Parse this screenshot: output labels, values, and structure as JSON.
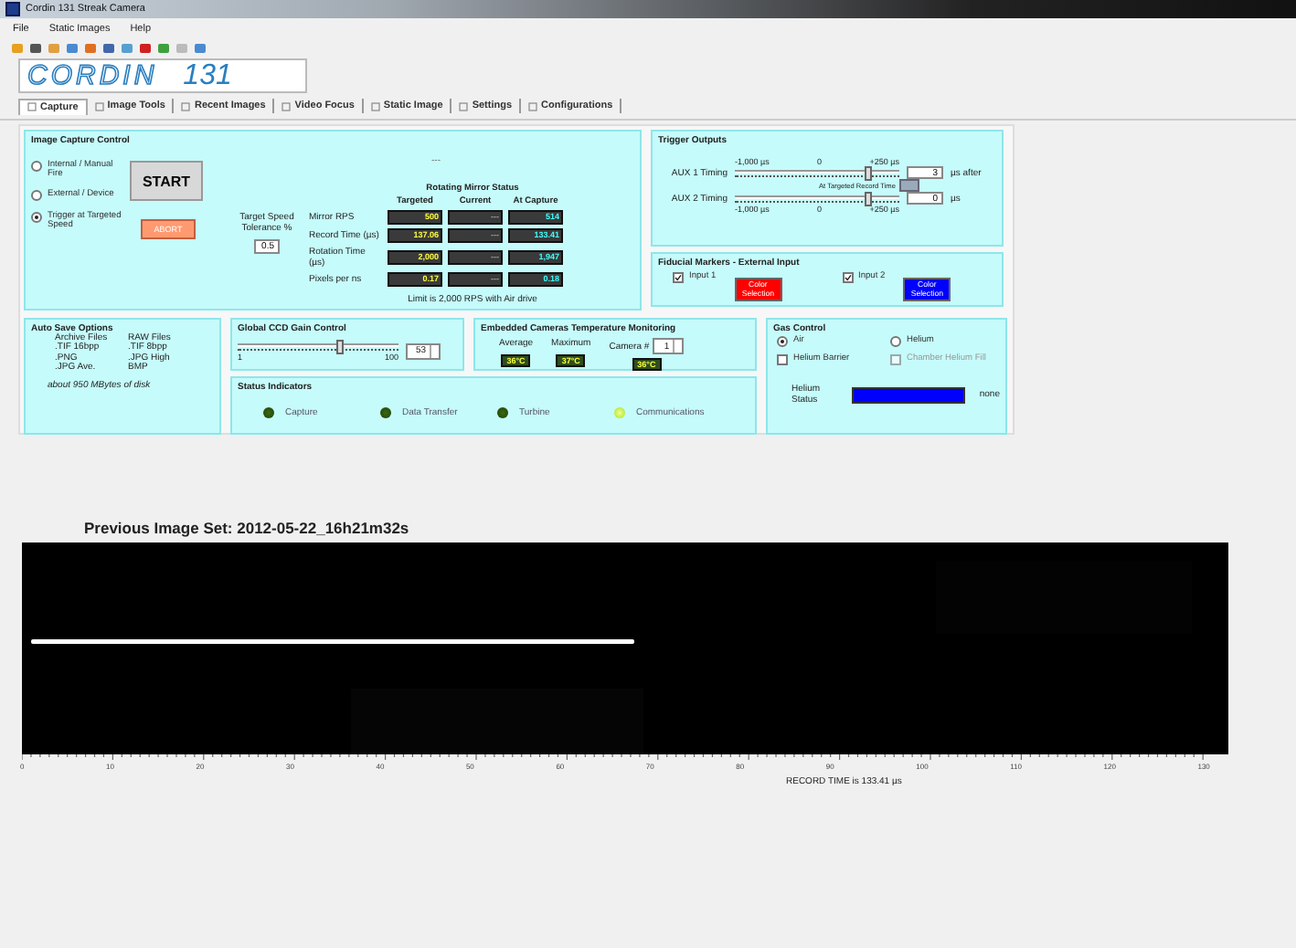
{
  "window": {
    "title": "Cordin 131 Streak Camera"
  },
  "menu": [
    "File",
    "Static Images",
    "Help"
  ],
  "logo": {
    "brand": "CORDIN",
    "model": "131"
  },
  "tabs": [
    {
      "label": "Capture",
      "selected": true
    },
    {
      "label": "Image Tools",
      "selected": false
    },
    {
      "label": "Recent Images",
      "selected": false
    },
    {
      "label": "Video Focus",
      "selected": false
    },
    {
      "label": "Static Image",
      "selected": false
    },
    {
      "label": "Settings",
      "selected": false
    },
    {
      "label": "Configurations",
      "selected": false
    }
  ],
  "capture_control": {
    "title": "Image Capture Control",
    "modes": [
      {
        "label": "Internal / Manual Fire",
        "selected": false
      },
      {
        "label": "External / Device",
        "selected": false
      },
      {
        "label": "Trigger at Targeted Speed",
        "selected": true
      }
    ],
    "start_button": "START",
    "abort_button": "ABORT",
    "dashes": "---",
    "tolerance": {
      "label": "Target Speed Tolerance %",
      "value": "0.5"
    },
    "mirror_status": {
      "title": "Rotating Mirror Status",
      "columns": [
        {
          "label": "Targeted",
          "kind": "target"
        },
        {
          "label": "Current",
          "kind": "current"
        },
        {
          "label": "At Capture",
          "kind": "capture"
        }
      ],
      "rows": [
        {
          "label": "Mirror RPS",
          "values": [
            "500",
            "---",
            "514"
          ]
        },
        {
          "label": "Record Time (µs)",
          "values": [
            "137.06",
            "---",
            "133.41"
          ]
        },
        {
          "label": "Rotation Time (µs)",
          "values": [
            "2,000",
            "---",
            "1,947"
          ]
        },
        {
          "label": "Pixels per ns",
          "values": [
            "0.17",
            "---",
            "0.18"
          ]
        }
      ],
      "note": "Limit is 2,000 RPS with Air drive"
    }
  },
  "trigger_outputs": {
    "title": "Trigger Outputs",
    "aux": [
      {
        "label": "AUX 1 Timing",
        "scale": [
          "-1,000 µs",
          "0",
          "+250 µs"
        ],
        "level": 0.8,
        "value": "3",
        "unit": "µs after"
      },
      {
        "label": "AUX 2 Timing",
        "scale": [
          "-1,000 µs",
          "0",
          "+250 µs"
        ],
        "level": 0.8,
        "value": "0",
        "unit": "µs"
      }
    ],
    "middle_label": "At Targeted Record Time"
  },
  "fiducial": {
    "title": "Fiducial Markers - External Input",
    "inputs": [
      {
        "label": "Input 1",
        "checked": true,
        "button": "Color Selection",
        "color": "#ff0000"
      },
      {
        "label": "Input 2",
        "checked": true,
        "button": "Color Selection",
        "color": "#0000ff"
      }
    ]
  },
  "auto_save": {
    "title": "Auto Save Options",
    "options": [
      "Archive Files",
      "RAW Files",
      ".TIF 16bpp",
      ".TIF 8bpp",
      ".PNG",
      ".JPG High",
      ".JPG Ave.",
      "BMP"
    ],
    "note": "about 950 MBytes of disk"
  },
  "gain": {
    "title": "Global CCD Gain Control",
    "level": 0.62,
    "value": "53",
    "min": "1",
    "max": "100"
  },
  "temperature": {
    "title": "Embedded Cameras Temperature Monitoring",
    "average": {
      "label": "Average",
      "value": "36°C"
    },
    "maximum": {
      "label": "Maximum",
      "value": "37°C"
    },
    "camera": {
      "label": "Camera #",
      "value": "1",
      "reading": "36°C"
    }
  },
  "status": {
    "title": "Status Indicators",
    "indicators": [
      {
        "label": "Capture",
        "on": false
      },
      {
        "label": "Data Transfer",
        "on": false
      },
      {
        "label": "Turbine",
        "on": false
      },
      {
        "label": "Communications",
        "on": true
      }
    ]
  },
  "gas": {
    "title": "Gas Control",
    "radios": [
      {
        "label": "Air",
        "selected": true
      },
      {
        "label": "Helium",
        "selected": false
      }
    ],
    "checks": [
      {
        "label": "Helium Barrier",
        "checked": false,
        "disabled": false
      },
      {
        "label": "Chamber Helium Fill",
        "checked": false,
        "disabled": true
      }
    ],
    "helium_status": {
      "label": "Helium Status",
      "color": "#0000ff",
      "reading": "none"
    }
  },
  "image_set": {
    "title": "Previous Image Set: 2012-05-22_16h21m32s",
    "ticks": [
      "0",
      "10",
      "20",
      "30",
      "40",
      "50",
      "60",
      "70",
      "80",
      "90",
      "100",
      "110",
      "120",
      "130"
    ],
    "record_time": "RECORD TIME is 133.41 µs"
  }
}
